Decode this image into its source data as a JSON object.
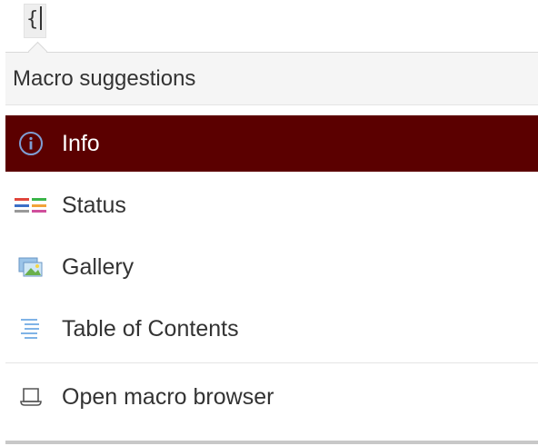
{
  "editor": {
    "typed_text": "{"
  },
  "dropdown": {
    "header": "Macro suggestions",
    "items": [
      {
        "label": "Info",
        "icon": "info-icon",
        "selected": true
      },
      {
        "label": "Status",
        "icon": "status-icon",
        "selected": false
      },
      {
        "label": "Gallery",
        "icon": "gallery-icon",
        "selected": false
      },
      {
        "label": "Table of Contents",
        "icon": "table-of-contents-icon",
        "selected": false
      }
    ],
    "footer_item": {
      "label": "Open macro browser",
      "icon": "macro-browser-icon"
    }
  },
  "colors": {
    "selected_bg": "#5b0000",
    "text": "#333333",
    "header_bg": "#f5f5f5"
  }
}
